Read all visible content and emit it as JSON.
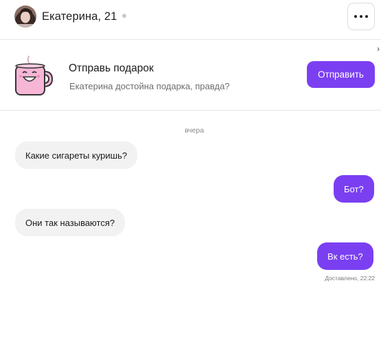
{
  "header": {
    "name": "Екатерина, 21",
    "more_icon": "more-horizontal-icon"
  },
  "gift": {
    "title": "Отправь подарок",
    "subtitle": "Екатерина достойна подарка, правда?",
    "button_label": "Отправить",
    "icon": "mug-icon",
    "close_glyph": "›"
  },
  "chat": {
    "date_separator": "вчера",
    "messages": [
      {
        "direction": "in",
        "text": "Какие сигареты куришь?"
      },
      {
        "direction": "out",
        "text": "Бот?"
      },
      {
        "direction": "in",
        "text": "Они так называются?"
      },
      {
        "direction": "out",
        "text": "Вк есть?"
      }
    ],
    "status": "Доставлено, 22:22"
  },
  "colors": {
    "accent": "#7b3ff2",
    "incoming_bubble": "#f2f2f2",
    "mug_pink": "#f7b6d6"
  }
}
